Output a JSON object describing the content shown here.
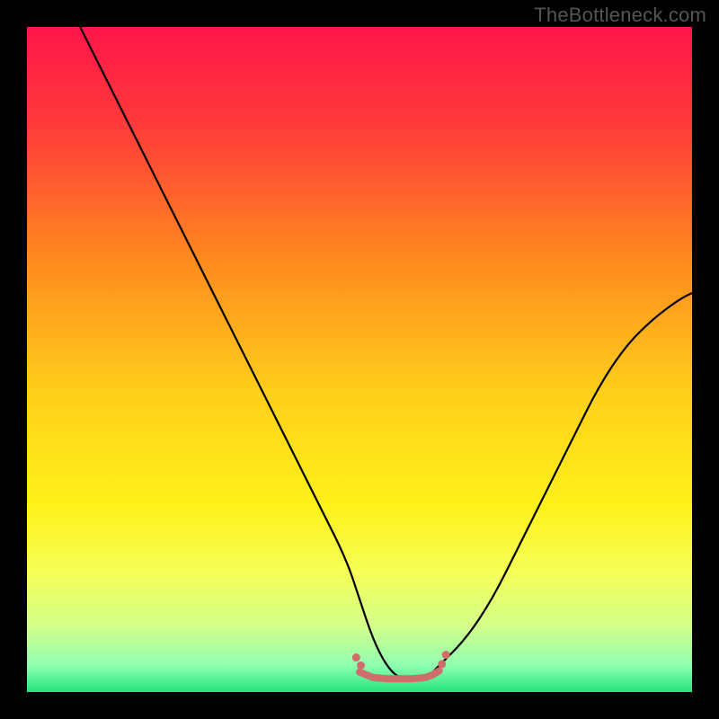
{
  "watermark": "TheBottleneck.com",
  "chart_data": {
    "type": "line",
    "title": "",
    "xlabel": "",
    "ylabel": "",
    "xlim": [
      0,
      100
    ],
    "ylim": [
      0,
      100
    ],
    "grid": false,
    "legend": false,
    "gradient_stops": [
      {
        "offset": 0.0,
        "color": "#ff164a"
      },
      {
        "offset": 0.15,
        "color": "#ff3b3a"
      },
      {
        "offset": 0.35,
        "color": "#ff8a1f"
      },
      {
        "offset": 0.55,
        "color": "#ffcf1a"
      },
      {
        "offset": 0.72,
        "color": "#fff11a"
      },
      {
        "offset": 0.82,
        "color": "#f6ff57"
      },
      {
        "offset": 0.9,
        "color": "#d4ff8a"
      },
      {
        "offset": 0.96,
        "color": "#8fffb0"
      },
      {
        "offset": 1.0,
        "color": "#24e47e"
      }
    ],
    "series": [
      {
        "name": "bottleneck-curve",
        "stroke": "#000000",
        "stroke_width": 2.2,
        "x": [
          8,
          12,
          16,
          20,
          24,
          28,
          32,
          36,
          40,
          44,
          48,
          50,
          52,
          54,
          56,
          58,
          60,
          62,
          66,
          70,
          74,
          78,
          82,
          86,
          90,
          94,
          98,
          100
        ],
        "y": [
          100,
          92,
          84,
          76,
          68,
          60,
          52,
          44,
          36,
          28,
          20,
          14,
          8,
          4,
          2,
          2,
          2,
          4,
          8,
          14,
          22,
          30,
          38,
          46,
          52,
          56,
          59,
          60
        ]
      }
    ],
    "flat_region": {
      "color": "#cf6d6d",
      "width": 8,
      "x": [
        50,
        52,
        54,
        56,
        57,
        58,
        60,
        61,
        62
      ],
      "y": [
        3.0,
        2.2,
        2.0,
        2.0,
        2.0,
        2.0,
        2.2,
        2.6,
        3.2
      ]
    },
    "flat_region_dots": {
      "color": "#cf6d6d",
      "radius": 4.5,
      "points": [
        {
          "x": 49.5,
          "y": 5.2
        },
        {
          "x": 50.2,
          "y": 4.0
        },
        {
          "x": 62.4,
          "y": 4.2
        },
        {
          "x": 63.0,
          "y": 5.6
        }
      ]
    }
  }
}
